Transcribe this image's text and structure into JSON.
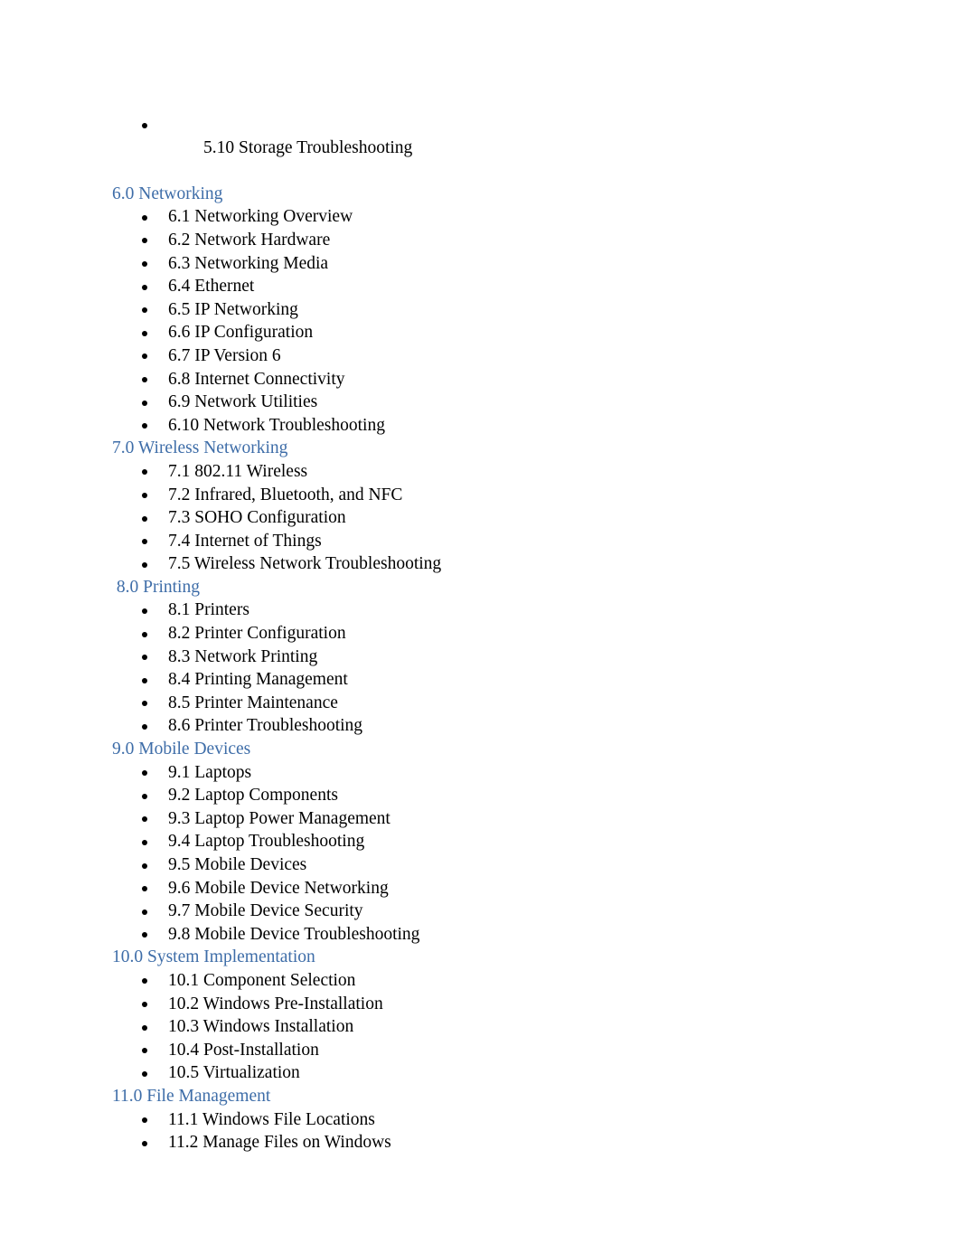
{
  "document": {
    "title": "Course Outline Table of Contents",
    "heading_color": "#3e6da8",
    "body_color": "#000000",
    "background_color": "#ffffff",
    "bullet_glyph": "bullet-disc"
  },
  "orphan_item": {
    "label": "5.10 Storage Troubleshooting"
  },
  "sections": [
    {
      "heading": "6.0 Networking",
      "items": [
        "6.1 Networking Overview",
        "6.2 Network Hardware",
        "6.3 Networking Media",
        "6.4 Ethernet",
        "6.5 IP Networking",
        "6.6 IP Configuration",
        "6.7 IP Version 6",
        "6.8 Internet Connectivity",
        "6.9 Network Utilities",
        "6.10 Network Troubleshooting"
      ]
    },
    {
      "heading": "7.0 Wireless Networking",
      "items": [
        "7.1 802.11 Wireless",
        "7.2 Infrared, Bluetooth, and NFC",
        "7.3 SOHO Configuration",
        "7.4 Internet of Things",
        "7.5 Wireless Network Troubleshooting"
      ]
    },
    {
      "heading": " 8.0 Printing",
      "items": [
        "8.1 Printers",
        "8.2 Printer Configuration",
        "8.3 Network Printing",
        "8.4 Printing Management",
        "8.5 Printer Maintenance",
        "8.6 Printer Troubleshooting"
      ]
    },
    {
      "heading": "9.0 Mobile Devices",
      "items": [
        "9.1 Laptops",
        "9.2 Laptop Components",
        "9.3 Laptop Power Management",
        "9.4 Laptop Troubleshooting",
        "9.5 Mobile Devices",
        "9.6 Mobile Device Networking",
        "9.7 Mobile Device Security",
        "9.8 Mobile Device Troubleshooting"
      ]
    },
    {
      "heading": "10.0 System Implementation",
      "items": [
        "10.1 Component Selection",
        "10.2 Windows Pre-Installation",
        "10.3 Windows Installation",
        "10.4 Post-Installation",
        "10.5 Virtualization"
      ]
    },
    {
      "heading": "11.0 File Management",
      "items": [
        "11.1 Windows File Locations",
        "11.2 Manage Files on Windows"
      ]
    }
  ]
}
